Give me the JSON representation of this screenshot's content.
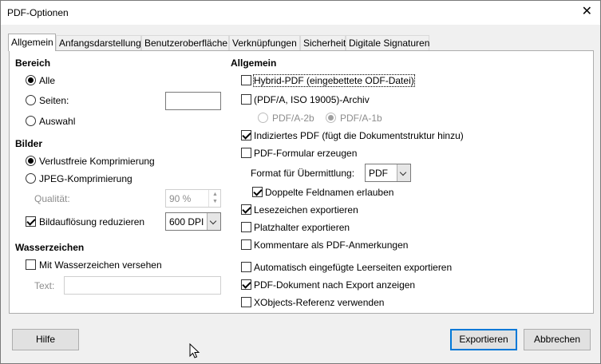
{
  "window": {
    "title": "PDF-Optionen",
    "close_glyph": "✕"
  },
  "tabs": [
    {
      "label": "Allgemein"
    },
    {
      "label": "Anfangsdarstellung"
    },
    {
      "label": "Benutzeroberfläche"
    },
    {
      "label": "Verknüpfungen"
    },
    {
      "label": "Sicherheit"
    },
    {
      "label": "Digitale Signaturen"
    }
  ],
  "bereich": {
    "heading": "Bereich",
    "alle": "Alle",
    "seiten": "Seiten:",
    "seiten_value": "",
    "auswahl": "Auswahl"
  },
  "bilder": {
    "heading": "Bilder",
    "verlustfrei": "Verlustfreie Komprimierung",
    "jpeg": "JPEG-Komprimierung",
    "qualitaet_label": "Qualität:",
    "qualitaet_value": "90 %",
    "reduce_label": "Bildauflösung reduzieren",
    "dpi_value": "600 DPI"
  },
  "wasserzeichen": {
    "heading": "Wasserzeichen",
    "mit_label": "Mit Wasserzeichen versehen",
    "text_label": "Text:",
    "text_value": ""
  },
  "allgemein": {
    "heading": "Allgemein",
    "hybrid": "Hybrid-PDF (eingebettete ODF-Datei)",
    "archiv": "(PDF/A, ISO 19005)-Archiv",
    "pdfa2b": "PDF/A-2b",
    "pdfa1b": "PDF/A-1b",
    "indiziert": "Indiziertes PDF (fügt die Dokumentstruktur hinzu)",
    "formular": "PDF-Formular erzeugen",
    "format_label": "Format für Übermittlung:",
    "format_value": "PDF",
    "doppelte": "Doppelte Feldnamen erlauben",
    "lesezeichen": "Lesezeichen exportieren",
    "platzhalter": "Platzhalter exportieren",
    "kommentare": "Kommentare als PDF-Anmerkungen",
    "leerseiten": "Automatisch eingefügte Leerseiten exportieren",
    "anzeigen": "PDF-Dokument nach Export anzeigen",
    "xobjects": "XObjects-Referenz verwenden"
  },
  "buttons": {
    "hilfe": "Hilfe",
    "exportieren": "Exportieren",
    "abbrechen": "Abbrechen"
  }
}
